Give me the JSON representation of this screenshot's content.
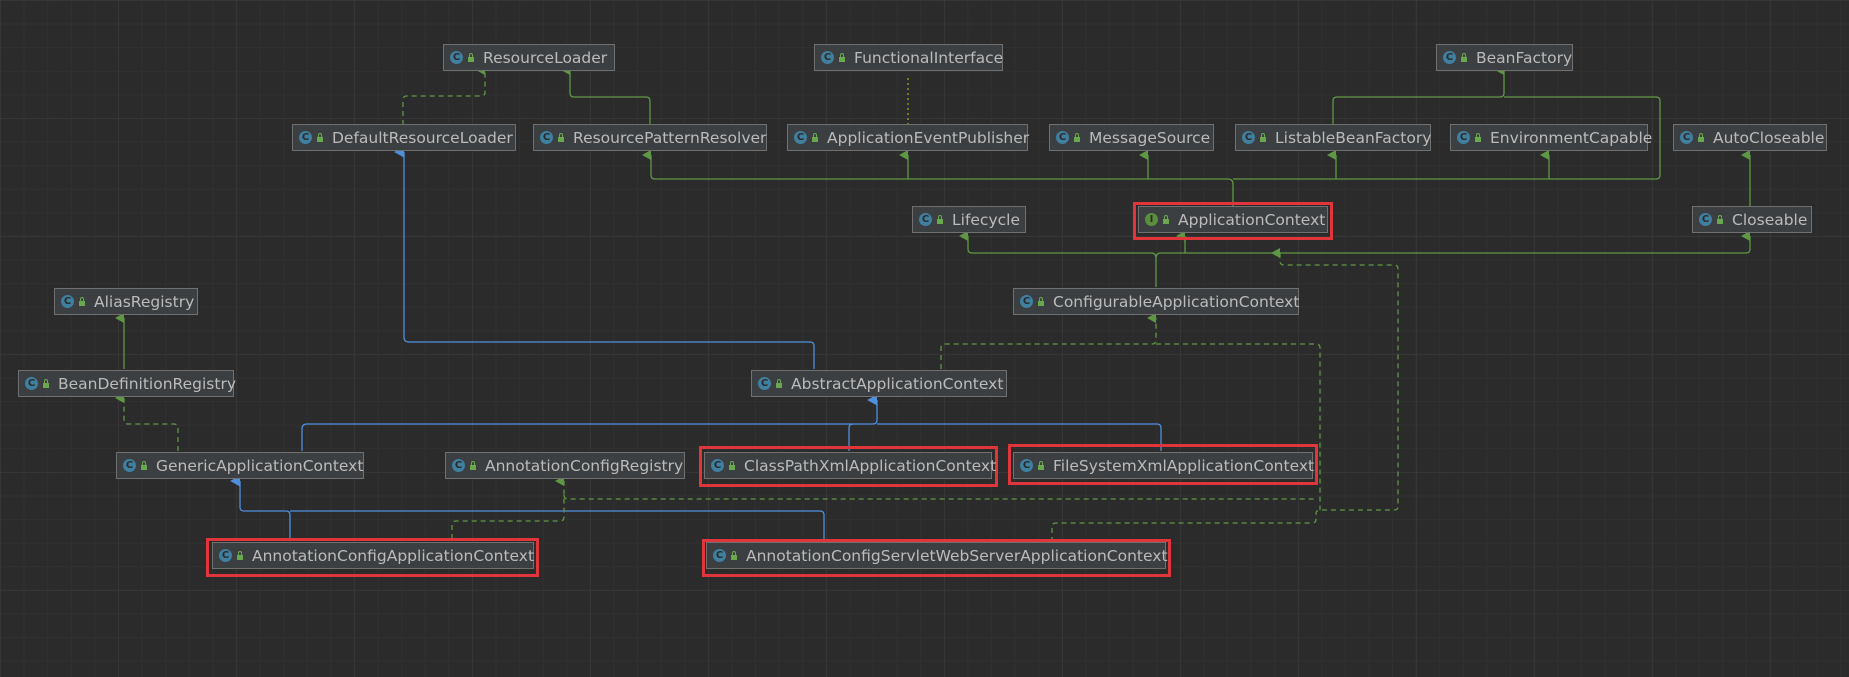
{
  "nodes": {
    "resourceLoader": {
      "name": "ResourceLoader",
      "badge": "C"
    },
    "functionalInterface": {
      "name": "FunctionalInterface",
      "badge": "C"
    },
    "beanFactory": {
      "name": "BeanFactory",
      "badge": "C"
    },
    "defaultResourceLoader": {
      "name": "DefaultResourceLoader",
      "badge": "C"
    },
    "resourcePatternResolver": {
      "name": "ResourcePatternResolver",
      "badge": "C"
    },
    "applicationEventPublisher": {
      "name": "ApplicationEventPublisher",
      "badge": "C"
    },
    "messageSource": {
      "name": "MessageSource",
      "badge": "C"
    },
    "listableBeanFactory": {
      "name": "ListableBeanFactory",
      "badge": "C"
    },
    "environmentCapable": {
      "name": "EnvironmentCapable",
      "badge": "C"
    },
    "autoCloseable": {
      "name": "AutoCloseable",
      "badge": "C"
    },
    "lifecycle": {
      "name": "Lifecycle",
      "badge": "C"
    },
    "applicationContext": {
      "name": "ApplicationContext",
      "badge": "I"
    },
    "closeable": {
      "name": "Closeable",
      "badge": "C"
    },
    "aliasRegistry": {
      "name": "AliasRegistry",
      "badge": "C"
    },
    "configurableApplicationContext": {
      "name": "ConfigurableApplicationContext",
      "badge": "C"
    },
    "beanDefinitionRegistry": {
      "name": "BeanDefinitionRegistry",
      "badge": "C"
    },
    "abstractApplicationContext": {
      "name": "AbstractApplicationContext",
      "badge": "C"
    },
    "genericApplicationContext": {
      "name": "GenericApplicationContext",
      "badge": "C"
    },
    "annotationConfigRegistry": {
      "name": "AnnotationConfigRegistry",
      "badge": "C"
    },
    "classPathXmlApplicationContext": {
      "name": "ClassPathXmlApplicationContext",
      "badge": "C"
    },
    "fileSystemXmlApplicationContext": {
      "name": "FileSystemXmlApplicationContext",
      "badge": "C"
    },
    "annotationConfigApplicationContext": {
      "name": "AnnotationConfigApplicationContext",
      "badge": "C"
    },
    "annotationConfigServletWebServerApplicationContext": {
      "name": "AnnotationConfigServletWebServerApplicationContext",
      "badge": "C"
    }
  },
  "colors": {
    "background": "#2b2b2b",
    "implements_edge": "#5f9845",
    "extends_edge": "#4f8fdc",
    "highlight": "#e0353b"
  }
}
